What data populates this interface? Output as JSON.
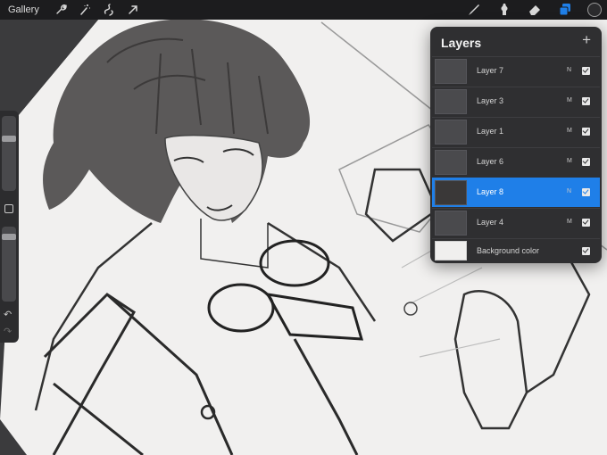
{
  "toolbar": {
    "gallery_label": "Gallery",
    "left_tools": [
      "wrench-icon",
      "magic-wand-icon",
      "selection-icon",
      "transform-arrow-icon"
    ],
    "right_tools": [
      "brush-icon",
      "smudge-icon",
      "eraser-icon",
      "layers-icon"
    ],
    "active_tool": "layers-icon",
    "color_swatch": "#2b2b2d"
  },
  "sidebar": {
    "size_slider_level": 0.72,
    "opacity_slider_level": 0.9
  },
  "layers": {
    "title": "Layers",
    "add_symbol": "+",
    "items": [
      {
        "name": "Layer 7",
        "mode": "N",
        "visible": true,
        "active": false
      },
      {
        "name": "Layer 3",
        "mode": "M",
        "visible": true,
        "active": false
      },
      {
        "name": "Layer 1",
        "mode": "M",
        "visible": true,
        "active": false
      },
      {
        "name": "Layer 6",
        "mode": "M",
        "visible": true,
        "active": false
      },
      {
        "name": "Layer 8",
        "mode": "N",
        "visible": true,
        "active": true
      },
      {
        "name": "Layer 4",
        "mode": "M",
        "visible": true,
        "active": false
      }
    ],
    "background": {
      "name": "Background color",
      "visible": true
    }
  },
  "colors": {
    "accent": "#1f7fe8",
    "panel": "#2f2f31",
    "canvas_paper": "#f1f0ef"
  }
}
